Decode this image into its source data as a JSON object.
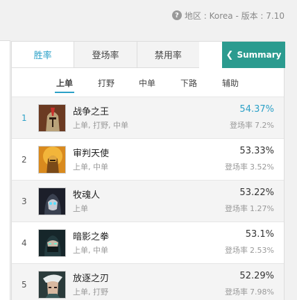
{
  "header": {
    "region_text": "地区 : Korea - 版本 : 7.10"
  },
  "tabs": [
    {
      "label": "胜率",
      "active": true
    },
    {
      "label": "登场率",
      "active": false
    },
    {
      "label": "禁用率",
      "active": false
    }
  ],
  "summary_button": {
    "label": "Summary",
    "icon": "chevron-left-icon"
  },
  "subtabs": [
    {
      "label": "上单",
      "active": true
    },
    {
      "label": "打野",
      "active": false
    },
    {
      "label": "中单",
      "active": false
    },
    {
      "label": "下路",
      "active": false
    },
    {
      "label": "辅助",
      "active": false
    }
  ],
  "pickrate_label": "登场率",
  "champions": [
    {
      "rank": "1",
      "name": "战争之王",
      "roles": "上单, 打野, 中单",
      "winrate": "54.37%",
      "pickrate": "7.2%",
      "highlight": true
    },
    {
      "rank": "2",
      "name": "审判天使",
      "roles": "上单, 中单",
      "winrate": "53.33%",
      "pickrate": "3.52%",
      "highlight": false
    },
    {
      "rank": "3",
      "name": "牧魂人",
      "roles": "上单",
      "winrate": "53.22%",
      "pickrate": "1.27%",
      "highlight": false
    },
    {
      "rank": "4",
      "name": "暗影之拳",
      "roles": "上单, 中单",
      "winrate": "53.1%",
      "pickrate": "2.53%",
      "highlight": false
    },
    {
      "rank": "5",
      "name": "放逐之刃",
      "roles": "上单, 打野",
      "winrate": "52.29%",
      "pickrate": "7.98%",
      "highlight": false
    }
  ],
  "colors": {
    "accent": "#2aa0c7",
    "summary_bg": "#2b9b8f"
  }
}
